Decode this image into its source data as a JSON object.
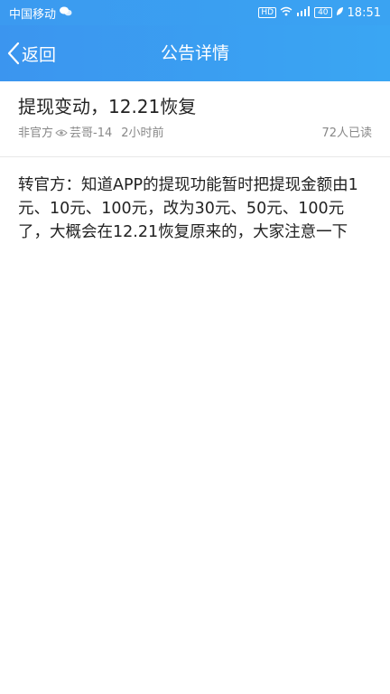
{
  "status_bar": {
    "carrier": "中国移动",
    "carrier_icon": "wechat-icon",
    "hd_badge": "HD",
    "signal_label": "4G",
    "battery_label": "40",
    "time": "18:51"
  },
  "nav": {
    "back_label": "返回",
    "title": "公告详情"
  },
  "post": {
    "title": "提现变动，12.21恢复",
    "source": "非官方",
    "author": "芸哥-14",
    "time": "2小时前",
    "read_count": "72人已读",
    "body": "转官方：知道APP的提现功能暂时把提现金额由1元、10元、100元，改为30元、50元、100元了，大概会在12.21恢复原来的，大家注意一下"
  },
  "colors": {
    "header_bg": "#3b9af0",
    "text": "#222222",
    "meta": "#888888"
  }
}
